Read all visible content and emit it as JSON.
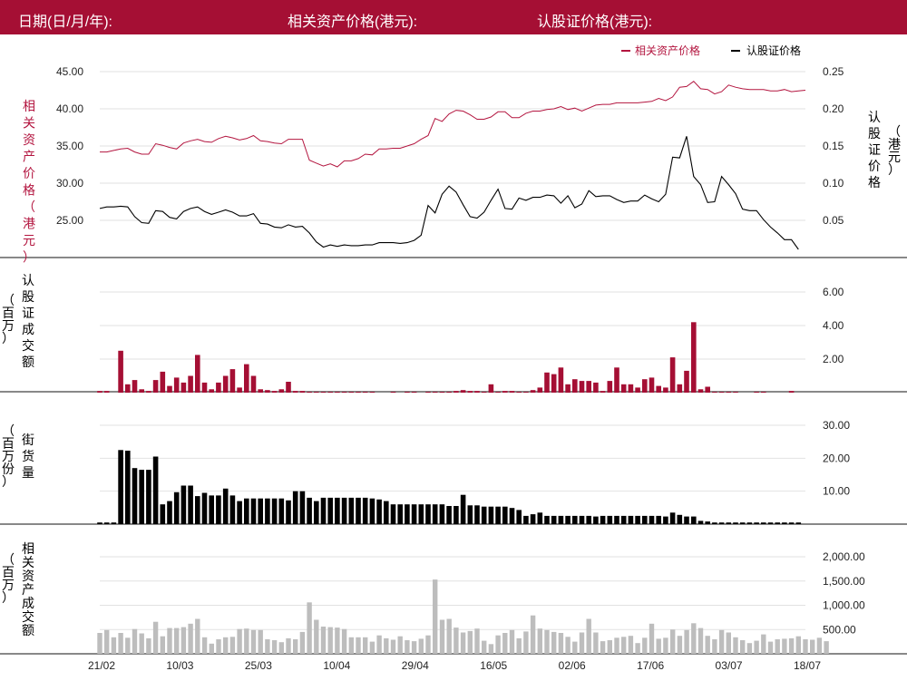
{
  "header": {
    "date_label": "日期(日/月/年):",
    "asset_price_label": "相关资产价格(港元):",
    "warrant_price_label": "认股证价格(港元):"
  },
  "colors": {
    "brand": "#a50f34",
    "asset_line": "#b3153f",
    "warrant_line": "#000000",
    "warrant_volume_bar": "#a50f34",
    "outstanding_bar": "#000000",
    "asset_volume_bar": "#bdbdbd"
  },
  "chart_data": [
    {
      "type": "line",
      "panel": "price",
      "legend": {
        "placement": "top-right"
      },
      "grid": true,
      "left_axis": {
        "label": "相关资产价格（港元）",
        "ticks": [
          25.0,
          30.0,
          35.0,
          40.0,
          45.0
        ],
        "tick_labels": [
          "25.00",
          "30.00",
          "35.00",
          "40.00",
          "45.00"
        ],
        "ylim": [
          20.0,
          45.0
        ]
      },
      "right_axis": {
        "label": "认股证价格（港元）",
        "ticks": [
          0.05,
          0.1,
          0.15,
          0.2,
          0.25
        ],
        "tick_labels": [
          "0.05",
          "0.10",
          "0.15",
          "0.20",
          "0.25"
        ],
        "ylim": [
          0.0,
          0.25
        ]
      },
      "series": [
        {
          "name": "相关资产价格",
          "axis": "left",
          "values": [
            34.2,
            34.2,
            34.4,
            34.6,
            34.7,
            34.2,
            33.9,
            33.9,
            35.3,
            35.1,
            34.8,
            34.6,
            35.4,
            35.7,
            35.9,
            35.6,
            35.5,
            36.0,
            36.3,
            36.1,
            35.8,
            36.0,
            36.4,
            35.7,
            35.6,
            35.4,
            35.3,
            35.9,
            35.9,
            35.9,
            33.1,
            32.7,
            32.3,
            32.6,
            32.2,
            33.0,
            33.0,
            33.3,
            33.9,
            33.8,
            34.6,
            34.6,
            34.7,
            34.7,
            35.0,
            35.3,
            35.9,
            36.4,
            38.7,
            38.3,
            39.3,
            39.8,
            39.7,
            39.2,
            38.6,
            38.6,
            38.9,
            39.6,
            39.6,
            38.8,
            38.8,
            39.4,
            39.7,
            39.7,
            39.9,
            40.0,
            40.3,
            39.9,
            40.1,
            39.7,
            40.1,
            40.5,
            40.6,
            40.6,
            40.8,
            40.8,
            40.8,
            40.8,
            40.9,
            41.0,
            41.4,
            41.1,
            41.6,
            42.9,
            43.0,
            43.7,
            42.7,
            42.6,
            42.0,
            42.3,
            43.2,
            42.9,
            42.7,
            42.6,
            42.6,
            42.6,
            42.4,
            42.4,
            42.6,
            42.3,
            42.4,
            42.5
          ]
        },
        {
          "name": "认股证价格",
          "axis": "right",
          "values": [
            0.066,
            0.068,
            0.068,
            0.069,
            0.068,
            0.055,
            0.047,
            0.046,
            0.063,
            0.062,
            0.054,
            0.052,
            0.062,
            0.066,
            0.068,
            0.062,
            0.058,
            0.061,
            0.064,
            0.061,
            0.056,
            0.056,
            0.059,
            0.046,
            0.045,
            0.041,
            0.04,
            0.044,
            0.041,
            0.042,
            0.033,
            0.021,
            0.014,
            0.017,
            0.015,
            0.017,
            0.016,
            0.016,
            0.017,
            0.017,
            0.02,
            0.02,
            0.02,
            0.019,
            0.02,
            0.023,
            0.03,
            0.07,
            0.06,
            0.085,
            0.096,
            0.088,
            0.071,
            0.055,
            0.053,
            0.061,
            0.077,
            0.092,
            0.066,
            0.065,
            0.08,
            0.077,
            0.081,
            0.081,
            0.084,
            0.083,
            0.073,
            0.083,
            0.067,
            0.072,
            0.09,
            0.082,
            0.083,
            0.083,
            0.078,
            0.074,
            0.076,
            0.076,
            0.084,
            0.079,
            0.075,
            0.085,
            0.135,
            0.134,
            0.163,
            0.109,
            0.098,
            0.074,
            0.075,
            0.109,
            0.098,
            0.086,
            0.065,
            0.063,
            0.063,
            0.051,
            0.041,
            0.033,
            0.024,
            0.024,
            0.011
          ]
        }
      ]
    },
    {
      "type": "bar",
      "panel": "warrant_volume",
      "grid": true,
      "ylabel": "认股证成交额（百万）",
      "ticks": [
        2.0,
        4.0,
        6.0
      ],
      "tick_labels": [
        "2.00",
        "4.00",
        "6.00"
      ],
      "ylim": [
        0,
        6.0
      ],
      "values": [
        0.1,
        0.1,
        0.05,
        2.5,
        0.5,
        0.75,
        0.2,
        0.1,
        0.75,
        1.25,
        0.4,
        0.9,
        0.6,
        1.0,
        2.25,
        0.6,
        0.2,
        0.6,
        1.0,
        1.4,
        0.3,
        1.7,
        1.0,
        0.2,
        0.15,
        0.1,
        0.2,
        0.65,
        0.1,
        0.1,
        0.05,
        0.05,
        0.05,
        0.05,
        0.05,
        0.05,
        0.05,
        0.05,
        0.05,
        0.05,
        0.05,
        0.05,
        0.05,
        0.05,
        0.05,
        0.05,
        0.05,
        0.05,
        0.05,
        0.05,
        0.05,
        0.1,
        0.15,
        0.1,
        0.1,
        0.05,
        0.5,
        0.05,
        0.1,
        0.1,
        0.05,
        0.05,
        0.15,
        0.3,
        1.2,
        1.1,
        1.5,
        0.5,
        0.8,
        0.7,
        0.7,
        0.6,
        0.1,
        0.7,
        1.5,
        0.5,
        0.5,
        0.3,
        0.8,
        0.9,
        0.4,
        0.3,
        2.1,
        0.5,
        1.3,
        4.2,
        0.2,
        0.35,
        0.05,
        0.05,
        0.05,
        0.05,
        0.05,
        0.05,
        0.05,
        0.05,
        0.05,
        0.05,
        0.05,
        0.1,
        0.05
      ],
      "present": [
        1,
        1,
        0,
        1,
        1,
        1,
        1,
        1,
        1,
        1,
        1,
        1,
        1,
        1,
        1,
        1,
        1,
        1,
        1,
        1,
        1,
        1,
        1,
        1,
        1,
        1,
        1,
        1,
        1,
        1,
        1,
        1,
        1,
        1,
        1,
        1,
        1,
        1,
        1,
        1,
        0,
        0,
        1,
        0,
        1,
        1,
        0,
        1,
        1,
        1,
        1,
        1,
        1,
        1,
        1,
        1,
        1,
        1,
        1,
        1,
        1,
        1,
        1,
        1,
        1,
        1,
        1,
        1,
        1,
        1,
        1,
        1,
        1,
        1,
        1,
        1,
        1,
        1,
        1,
        1,
        1,
        1,
        1,
        1,
        1,
        1,
        1,
        1,
        1,
        1,
        1,
        1,
        0,
        0,
        1,
        1,
        0,
        0,
        0,
        1,
        0
      ]
    },
    {
      "type": "bar",
      "panel": "outstanding",
      "grid": true,
      "ylabel": "街货量（百万份）",
      "ticks": [
        10.0,
        20.0,
        30.0
      ],
      "tick_labels": [
        "10.00",
        "20.00",
        "30.00"
      ],
      "ylim": [
        0,
        30.0
      ],
      "values": [
        0.5,
        0.5,
        0.5,
        22.5,
        22.3,
        17.0,
        16.5,
        16.5,
        20.5,
        6.0,
        7.0,
        9.7,
        11.7,
        11.7,
        8.5,
        9.5,
        8.7,
        8.7,
        10.8,
        8.7,
        7.0,
        7.8,
        7.8,
        7.8,
        7.8,
        7.8,
        7.8,
        7.2,
        10.0,
        10.0,
        8.0,
        7.0,
        8.0,
        8.0,
        8.0,
        8.0,
        8.0,
        8.0,
        8.0,
        7.8,
        7.5,
        7.0,
        6.0,
        6.0,
        6.0,
        6.0,
        6.0,
        6.0,
        6.0,
        6.0,
        5.5,
        5.5,
        8.9,
        5.7,
        5.7,
        5.3,
        5.3,
        5.3,
        5.3,
        4.9,
        4.3,
        2.5,
        3.0,
        3.5,
        2.5,
        2.5,
        2.5,
        2.5,
        2.5,
        2.5,
        2.5,
        2.3,
        2.5,
        2.5,
        2.5,
        2.5,
        2.5,
        2.5,
        2.5,
        2.5,
        2.5,
        2.3,
        3.5,
        2.8,
        2.3,
        2.3,
        1.0,
        0.8,
        0.5,
        0.5,
        0.5,
        0.5,
        0.5,
        0.5,
        0.5,
        0.5,
        0.5,
        0.5,
        0.5,
        0.5,
        0.5
      ]
    },
    {
      "type": "bar",
      "panel": "asset_volume",
      "grid": true,
      "ylabel": "相关资产成交额（百万）",
      "ticks": [
        500.0,
        1000.0,
        1500.0,
        2000.0
      ],
      "tick_labels": [
        "500.00",
        "1,000.00",
        "1,500.00",
        "2,000.00"
      ],
      "ylim": [
        0,
        2000.0
      ],
      "values": [
        430,
        490,
        340,
        430,
        330,
        510,
        420,
        320,
        660,
        360,
        530,
        530,
        550,
        620,
        720,
        340,
        210,
        300,
        340,
        350,
        510,
        520,
        490,
        490,
        300,
        280,
        240,
        320,
        300,
        450,
        1060,
        700,
        560,
        550,
        540,
        510,
        340,
        340,
        340,
        250,
        380,
        320,
        290,
        360,
        280,
        260,
        310,
        380,
        1530,
        700,
        720,
        540,
        440,
        470,
        520,
        270,
        200,
        380,
        430,
        490,
        320,
        460,
        790,
        520,
        490,
        450,
        430,
        350,
        250,
        440,
        720,
        440,
        260,
        280,
        330,
        350,
        370,
        220,
        330,
        620,
        310,
        330,
        500,
        370,
        490,
        630,
        530,
        370,
        300,
        490,
        440,
        340,
        280,
        220,
        270,
        400,
        250,
        300,
        310,
        320,
        360,
        300,
        290,
        330,
        260
      ],
      "x_tick_labels": [
        "21/02",
        "10/03",
        "25/03",
        "10/04",
        "29/04",
        "16/05",
        "02/06",
        "17/06",
        "03/07",
        "18/07"
      ]
    }
  ]
}
